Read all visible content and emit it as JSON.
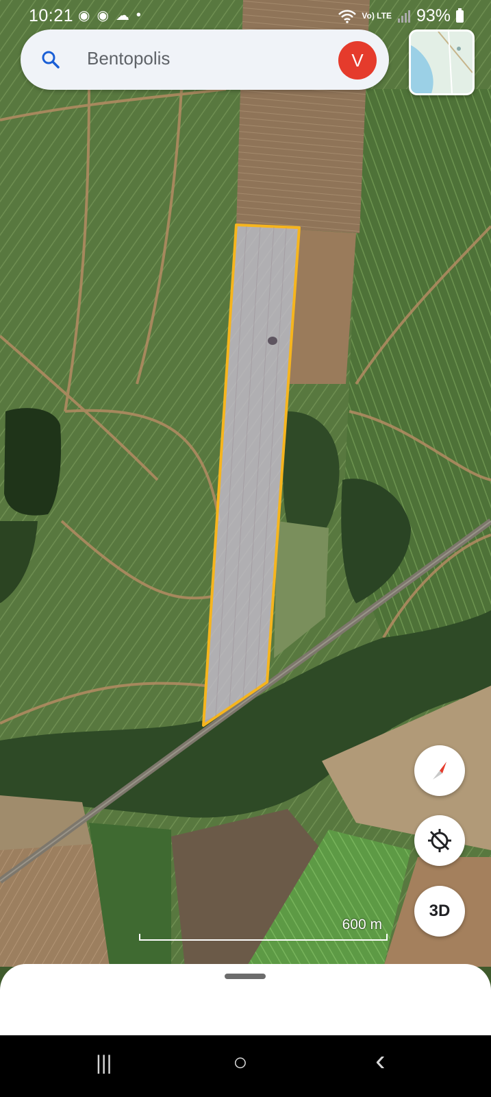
{
  "status_bar": {
    "time": "10:21",
    "network_label": "Vo) LTE",
    "battery": "93%"
  },
  "search": {
    "query": "Bentopolis",
    "avatar_initial": "V"
  },
  "map": {
    "layer_type": "satellite",
    "highlight_color": "#f6b51e",
    "scale_label": "600 m"
  },
  "controls": {
    "compass": "compass-icon",
    "location": "location-disabled-icon",
    "view_3d_label": "3D"
  },
  "bottom_sheet": {
    "handle": "drag-handle"
  },
  "nav_bar": {
    "recents": "|||",
    "home": "○",
    "back": "‹"
  }
}
